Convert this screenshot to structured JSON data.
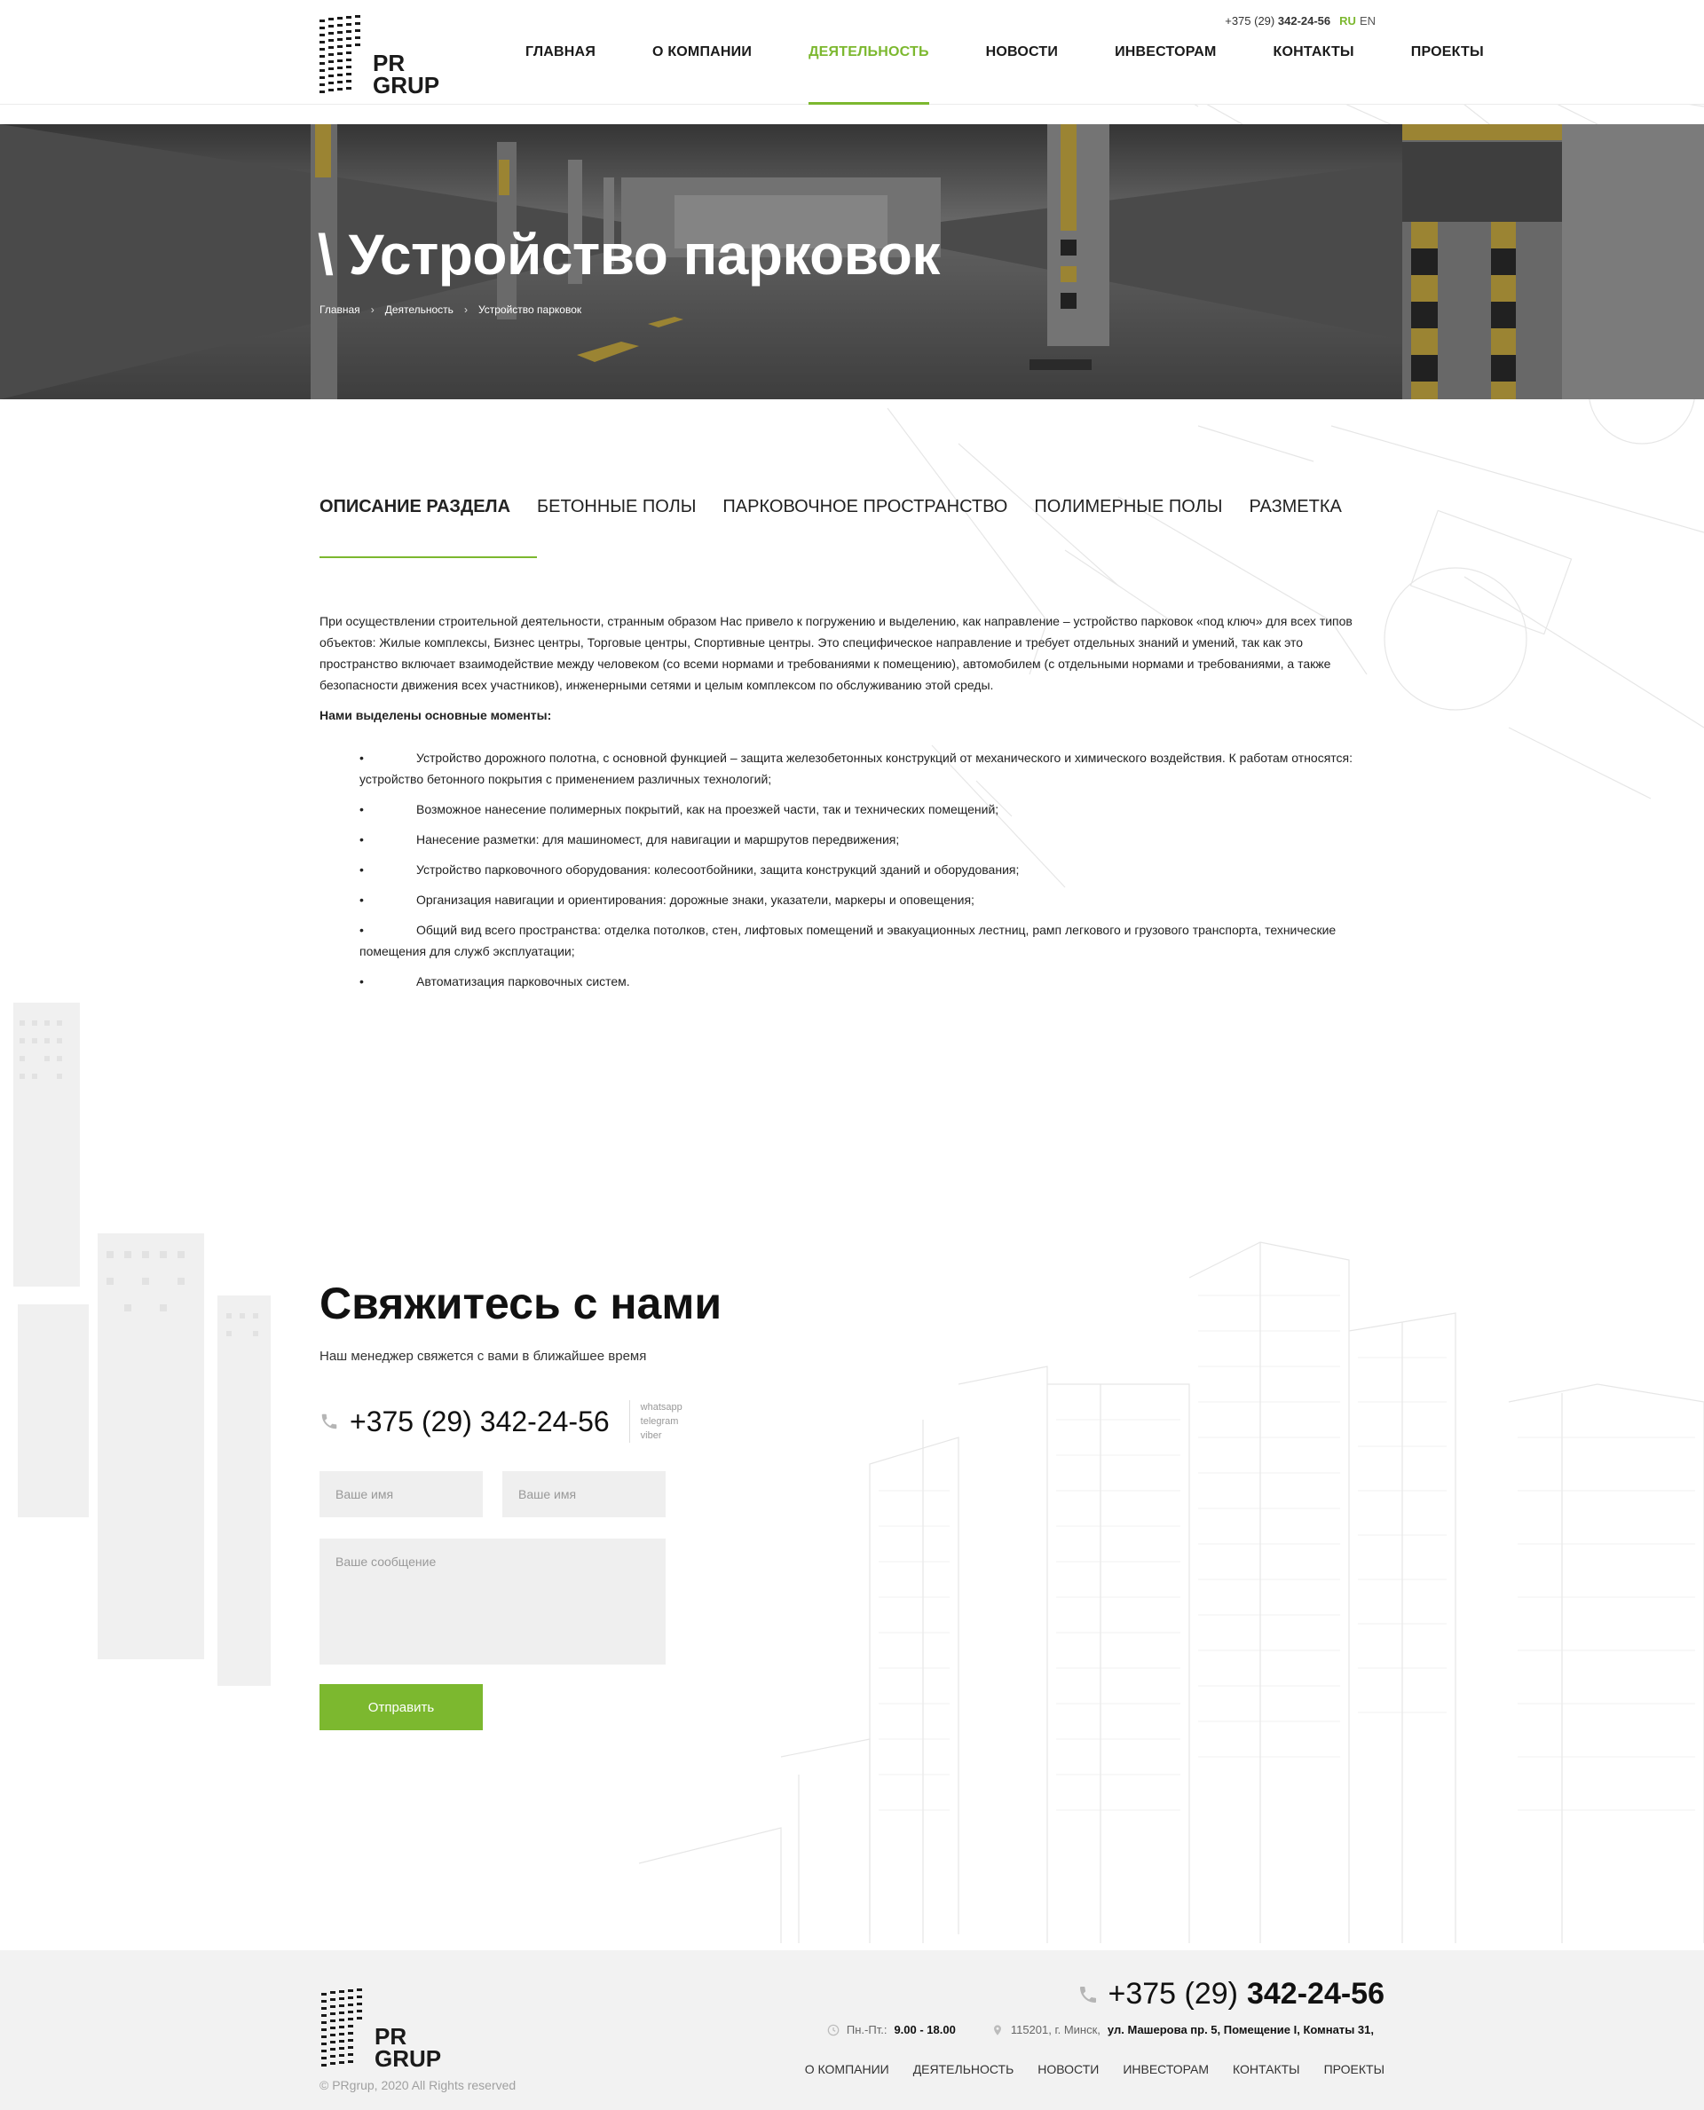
{
  "header": {
    "logo_text_1": "PR",
    "logo_text_2": "GRUP",
    "phone_prefix": "+375 (29)",
    "phone_number": "342-24-56",
    "lang_ru": "RU",
    "lang_en": "EN",
    "nav": [
      {
        "label": "Главная"
      },
      {
        "label": "О компании"
      },
      {
        "label": "Деятельность"
      },
      {
        "label": "Новости"
      },
      {
        "label": "Инвесторам"
      },
      {
        "label": "Контакты"
      },
      {
        "label": "Проекты"
      }
    ],
    "accent_color": "#7cb82f"
  },
  "hero": {
    "title": "\\ Устройство парковок",
    "breadcrumb": [
      "Главная",
      "Деятельность",
      "Устройство парковок"
    ],
    "separator": "›"
  },
  "tabs": [
    {
      "label": "Описание раздела"
    },
    {
      "label": "Бетонные полы"
    },
    {
      "label": "Парковочное пространство"
    },
    {
      "label": "Полимерные полы"
    },
    {
      "label": "Разметка"
    }
  ],
  "content": {
    "intro": "При осуществлении строительной деятельности, странным образом Нас привело к погружению и выделению, как направление – устройство парковок «под ключ» для всех типов объектов: Жилые комплексы, Бизнес центры, Торговые центры, Спортивные центры. Это специфическое направление и требует отдельных знаний и умений, так как это пространство включает взаимодействие между человеком (со всеми нормами и требованиями к помещению), автомобилем (с отдельными нормами и требованиями, а также безопасности движения всех участников), инженерными сетями и целым комплексом по обслуживанию этой среды.",
    "subheading": "Нами выделены основные моменты:",
    "bullet": "•",
    "items": [
      "Устройство дорожного полотна, с основной функцией – защита железобетонных конструкций от механического и химического воздействия. К работам относятся: устройство бетонного покрытия с применением различных технологий;",
      "Возможное нанесение полимерных покрытий, как на проезжей части, так и технических помещений;",
      "Нанесение разметки: для машиномест, для навигации и маршрутов передвижения;",
      "Устройство парковочного оборудования: колесоотбойники, защита конструкций зданий и оборудования;",
      "Организация навигации и ориентирования: дорожные знаки, указатели, маркеры и оповещения;",
      "Общий вид всего пространства: отделка потолков, стен, лифтовых помещений и эвакуационных лестниц, рамп легкового и грузового транспорта, технические помещения для служб эксплуатации;",
      "Автоматизация парковочных систем."
    ]
  },
  "contact": {
    "title": "Свяжитесь с нами",
    "subtitle": "Наш менеджер свяжется с вами в ближайшее время",
    "phone": "+375 (29) 342-24-56",
    "messengers": [
      "whatsapp",
      "telegram",
      "viber"
    ],
    "name_placeholder_1": "Ваше имя",
    "name_placeholder_2": "Ваше имя",
    "message_placeholder": "Ваше сообщение",
    "submit_label": "Отправить"
  },
  "footer": {
    "phone_prefix": "+375 (29)",
    "phone_number": "342-24-56",
    "hours_label": "Пн.-Пт.:",
    "hours_value": "9.00 - 18.00",
    "address_prefix": "115201, г. Минск,",
    "address_value": "ул. Машерова пр. 5, Помещение I, Комнаты 31,",
    "nav": [
      "О компании",
      "Деятельность",
      "Новости",
      "Инвесторам",
      "Контакты",
      "Проекты"
    ],
    "copyright": "© PRgrup, 2020 All Rights reserved"
  }
}
